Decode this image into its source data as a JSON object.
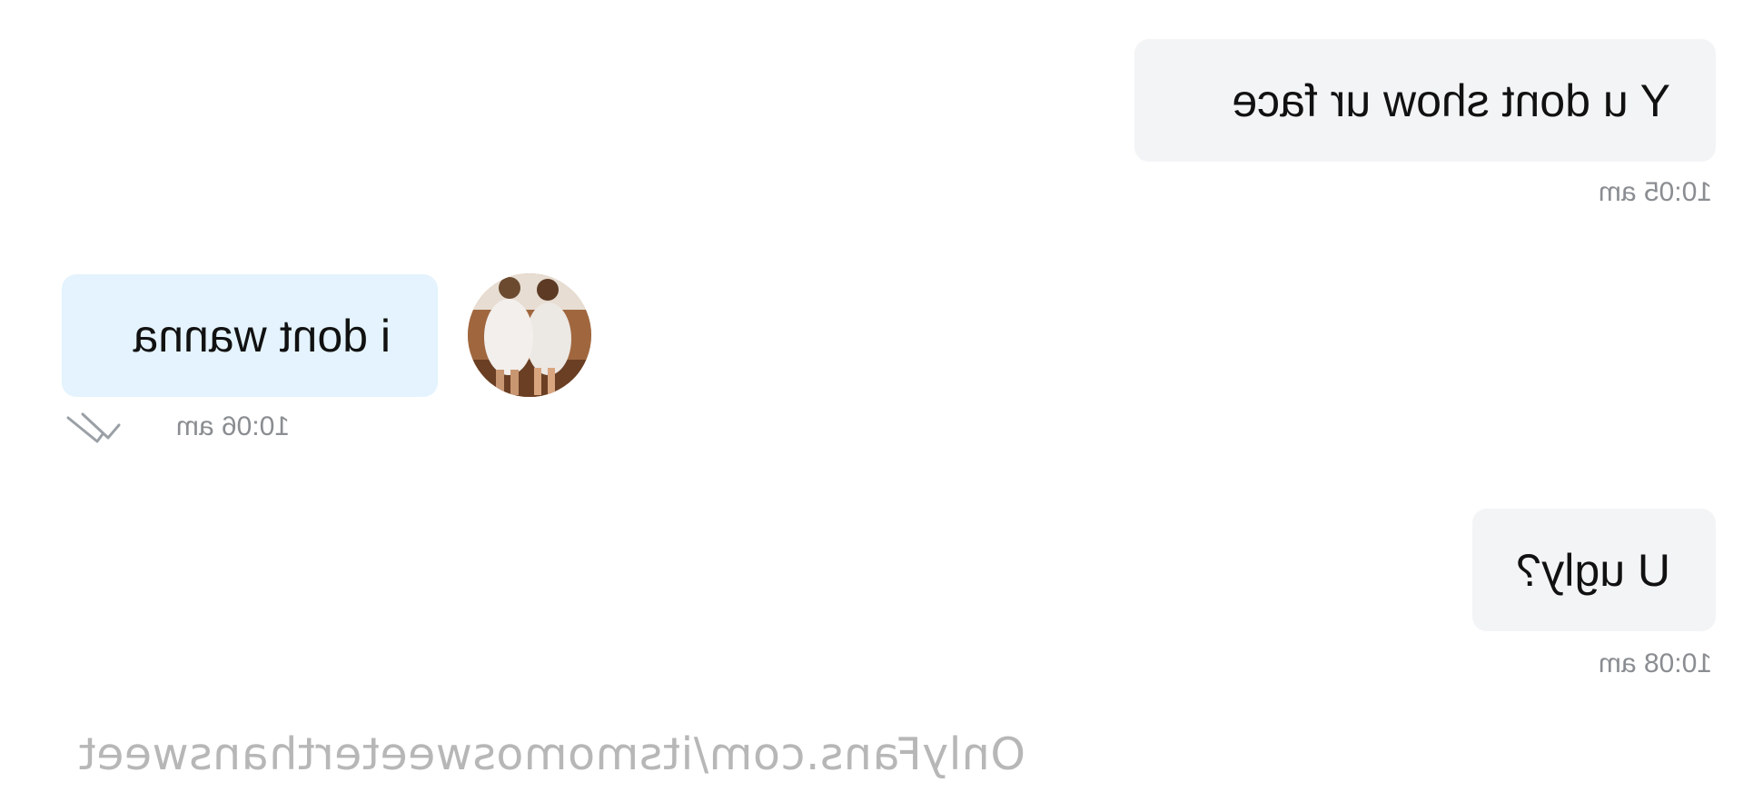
{
  "messages": [
    {
      "direction": "received",
      "text": "Y u dont show ur face",
      "time": "10:05 am"
    },
    {
      "direction": "sent",
      "text": "i dont wanna",
      "time": "10:06 am",
      "status_icon": "double-check-icon"
    },
    {
      "direction": "received",
      "text": "U ugly?",
      "time": "10:08 am"
    }
  ],
  "sender_avatar": {
    "icon": "avatar-photo"
  },
  "watermark": {
    "text": "OnlyFans.com/itsmomosweeterthansweet"
  },
  "colors": {
    "received_bubble": "#f3f4f6",
    "sent_bubble": "#e4f3fd",
    "timestamp": "#8a8d91",
    "watermark": "#b7b7b7"
  }
}
